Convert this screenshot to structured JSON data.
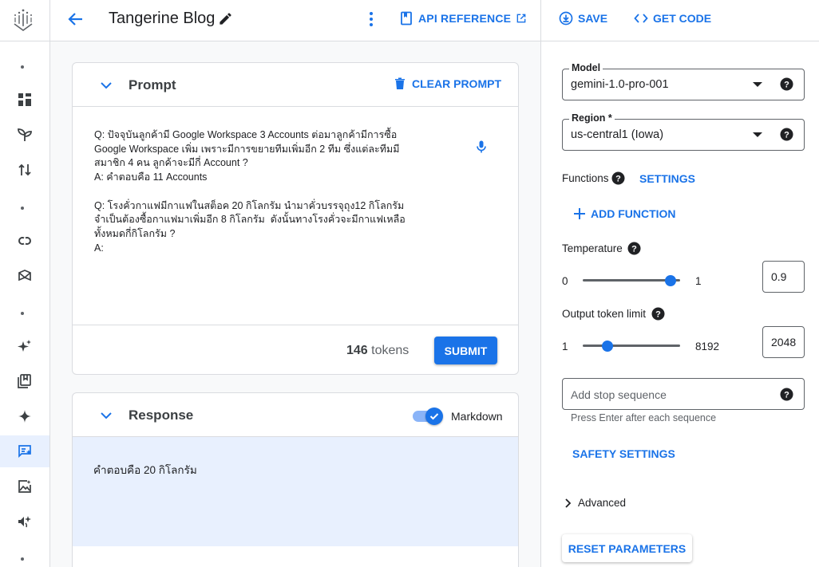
{
  "header": {
    "title": "Tangerine Blog",
    "api_reference": "API REFERENCE",
    "save": "SAVE",
    "get_code": "GET CODE"
  },
  "rail": {
    "icons": [
      "logo-icon",
      "dashboard-icon",
      "sprout-icon",
      "pipeline-icon",
      "colab-icon",
      "model-garden-icon",
      "sparkle-icon",
      "notebook-icon",
      "gemini-icon",
      "freeform-prompt-icon",
      "image-icon",
      "speech-icon"
    ],
    "active": "freeform-prompt-icon"
  },
  "prompt": {
    "title": "Prompt",
    "clear_label": "CLEAR PROMPT",
    "text": "Q: ปัจจุบันลูกค้ามี Google Workspace 3 Accounts ต่อมาลูกค้ามีการซื้อ\nGoogle Workspace เพิ่ม เพราะมีการขยายทีมเพิ่มอีก 2 ทีม ซึ่งแต่ละทีมมี\nสมาชิก 4 คน ลูกค้าจะมีกี่ Account ?\nA: คำตอบคือ 11 Accounts\n\nQ: โรงคั่วกาแฟมีกาแฟในสต็อค 20 กิโลกรัม นำมาคั่วบรรจุถุง12 กิโลกรัม\nจำเป็นต้องซื้อกาแฟมาเพิ่มอีก 8 กิโลกรัม  ดังนั้นทางโรงคั่วจะมีกาแฟเหลือ\nทั้งหมดกี่กิโลกรัม ?\nA:",
    "token_count": "146",
    "token_suffix": "tokens",
    "submit_label": "SUBMIT"
  },
  "response": {
    "title": "Response",
    "markdown_label": "Markdown",
    "markdown_on": true,
    "text": "คำตอบคือ 20 กิโลกรัม"
  },
  "params": {
    "model_label": "Model",
    "model_value": "gemini-1.0-pro-001",
    "region_label": "Region *",
    "region_value": "us-central1 (Iowa)",
    "functions_label": "Functions",
    "settings_label": "SETTINGS",
    "add_function_label": "ADD FUNCTION",
    "temperature_label": "Temperature",
    "temperature_min": "0",
    "temperature_max": "1",
    "temperature_value": "0.9",
    "temperature_fraction": 0.9,
    "output_limit_label": "Output token limit",
    "output_min": "1",
    "output_max": "8192",
    "output_value": "2048",
    "output_fraction": 0.25,
    "stop_placeholder": "Add stop sequence",
    "stop_hint": "Press Enter after each sequence",
    "safety_label": "SAFETY SETTINGS",
    "advanced_label": "Advanced",
    "reset_label": "RESET PARAMETERS"
  },
  "colors": {
    "accent": "#1a73e8",
    "response_bg": "#e8f0fe",
    "rail_active": "#e8f0fe"
  }
}
